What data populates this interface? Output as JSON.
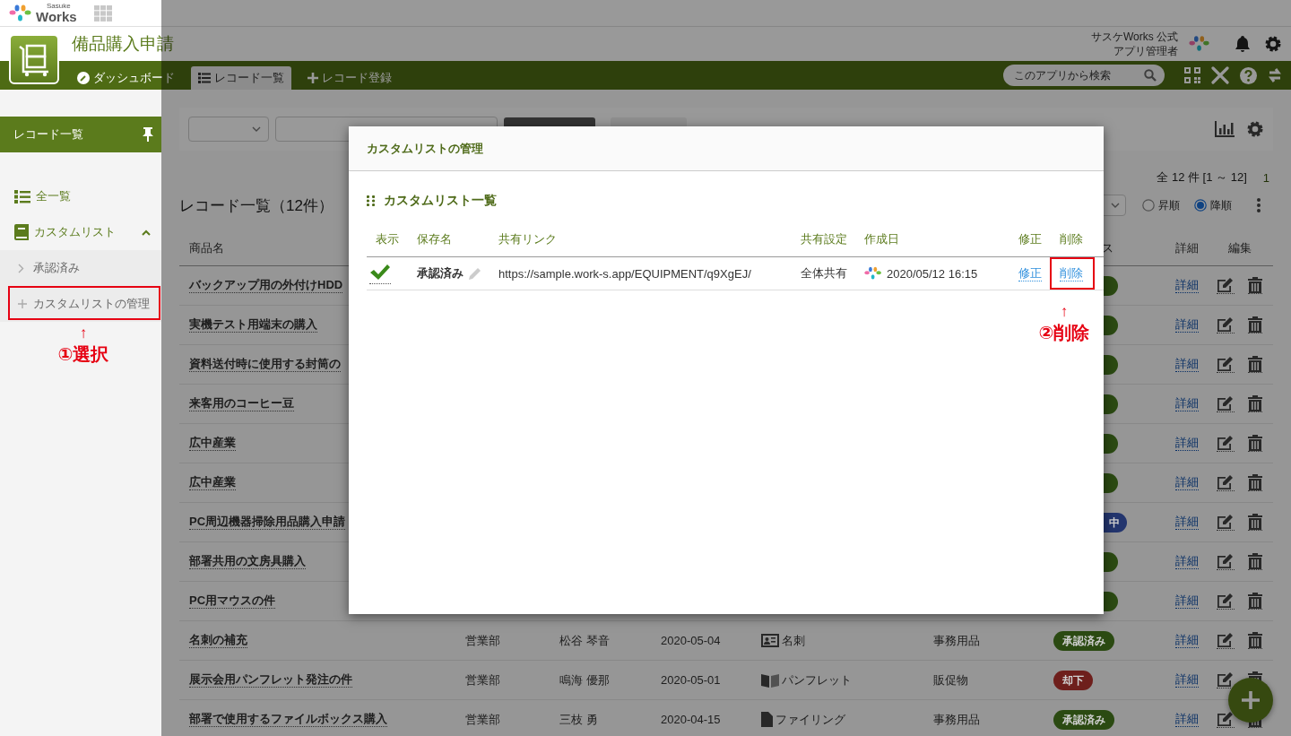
{
  "header": {
    "logo_small": "Sasuke",
    "logo": "Works"
  },
  "app": {
    "title": "備品購入申請"
  },
  "user": {
    "org": "サスケWorks 公式",
    "role": "アプリ管理者"
  },
  "nav": {
    "tabs": [
      {
        "label": "ダッシュボード",
        "kind": "gauge",
        "selected": false
      },
      {
        "label": "レコード一覧",
        "kind": "list",
        "selected": true
      },
      {
        "label": "レコード登録",
        "kind": "plus",
        "selected": false
      }
    ],
    "search": {
      "placeholder": "このアプリから検索"
    }
  },
  "sidebar": {
    "title": "レコード一覧",
    "items": [
      {
        "label": "全一覧",
        "kind": "list"
      },
      {
        "label": "カスタムリスト",
        "kind": "book",
        "expanded": true,
        "children": [
          {
            "label": "承認済み",
            "kind": "chevron",
            "highlighted": false
          },
          {
            "label": "カスタムリストの管理",
            "kind": "plus",
            "highlighted": true
          }
        ]
      }
    ]
  },
  "annotations": [
    {
      "arrow": "↑",
      "label": "①選択"
    },
    {
      "arrow": "↑",
      "label": "②削除"
    }
  ],
  "records": {
    "count": "全 12 件 [1 ～ 12]",
    "page": "1",
    "title": "レコード一覧（12件）",
    "sort": [
      {
        "label": "昇順",
        "selected": false
      },
      {
        "label": "降順",
        "selected": true
      }
    ],
    "columns": [
      "商品名",
      "ス",
      "詳細",
      "編集"
    ],
    "rows": [
      {
        "kind": "covered",
        "name": "バックアップ用の外付けHDD",
        "detail": "詳細",
        "status": {
          "color": "#2b4a12"
        }
      },
      {
        "kind": "covered",
        "name": "実機テスト用端末の購入",
        "detail": "詳細",
        "status": {
          "color": "#2b4a12"
        }
      },
      {
        "kind": "covered",
        "name": "資料送付時に使用する封筒の",
        "detail": "詳細",
        "status": {
          "color": "#2b4a12"
        }
      },
      {
        "kind": "covered",
        "name": "来客用のコーヒー豆",
        "detail": "詳細",
        "status": {
          "color": "#2b4a12"
        }
      },
      {
        "kind": "covered",
        "name": "広中産業",
        "detail": "詳細",
        "status": {
          "color": "#2b4a12"
        }
      },
      {
        "kind": "covered",
        "name": "広中産業",
        "detail": "詳細",
        "status": {
          "color": "#2b4a12"
        }
      },
      {
        "kind": "covered",
        "name": "PC周辺機器掃除用品購入申請",
        "detail": "詳細",
        "status": {
          "text": "中",
          "color": "#23356e"
        }
      },
      {
        "kind": "covered",
        "name": "部署共用の文房具購入",
        "detail": "詳細",
        "status": {
          "color": "#2b4a12"
        }
      },
      {
        "kind": "covered",
        "name": "PC用マウスの件",
        "detail": "詳細",
        "status": {
          "color": "#2b4a12"
        }
      },
      {
        "kind": "full",
        "name": "名刺の補充",
        "dept": "営業部",
        "person": "松谷 琴音",
        "date": "2020-05-04",
        "category": {
          "kind": "card",
          "label": "名刺"
        },
        "type": "事務用品",
        "detail": "詳細",
        "status": {
          "text": "承認済み",
          "color": "#2b4a12"
        }
      },
      {
        "kind": "full",
        "name": "展示会用パンフレット発注の件",
        "dept": "営業部",
        "person": "鳴海 優那",
        "date": "2020-05-01",
        "category": {
          "kind": "book",
          "label": "パンフレット"
        },
        "type": "販促物",
        "detail": "詳細",
        "status": {
          "text": "却下",
          "color": "#6e1f1c"
        }
      },
      {
        "kind": "full",
        "name": "部署で使用するファイルボックス購入",
        "dept": "営業部",
        "person": "三枝 勇",
        "date": "2020-04-15",
        "category": {
          "kind": "file",
          "label": "ファイリング"
        },
        "type": "事務用品",
        "detail": "詳細",
        "status": {
          "text": "承認済み",
          "color": "#2b4a12"
        }
      }
    ]
  },
  "modal": {
    "title": "カスタムリストの管理",
    "section": "カスタムリスト一覧",
    "columns": [
      "表示",
      "保存名",
      "共有リンク",
      "共有設定",
      "作成日",
      "修正",
      "削除"
    ],
    "rows": [
      {
        "visible": true,
        "name": "承認済み",
        "link": "https://sample.work-s.app/EQUIPMENT/q9XgEJ/",
        "sharing": "全体共有",
        "created": "2020/05/12 16:15",
        "edit": "修正",
        "delete": "削除",
        "delete_highlighted": true
      }
    ]
  }
}
